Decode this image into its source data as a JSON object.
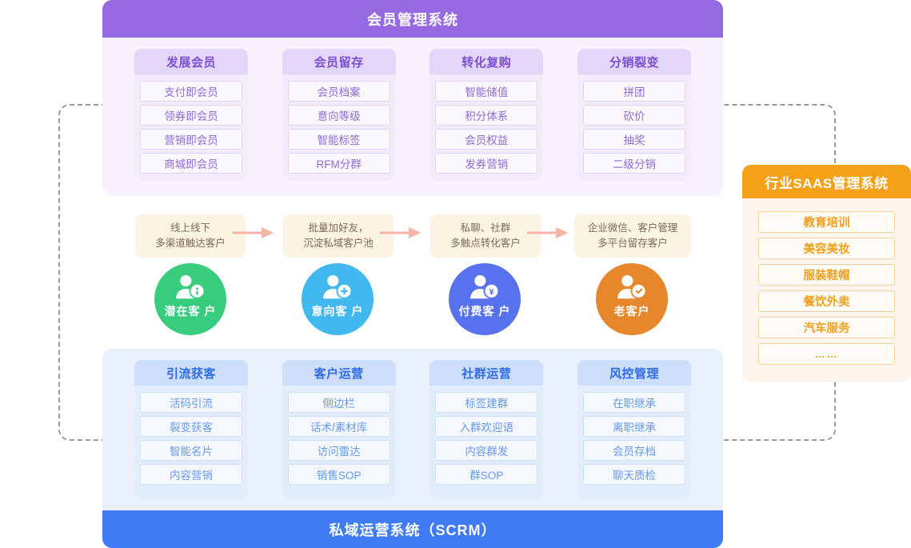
{
  "frame": {
    "border_color": "#9a9a9a"
  },
  "top_panel": {
    "title": "会员管理系统",
    "header_color": "#9569E0",
    "body_color": "#F7F2FE",
    "columns": [
      {
        "title": "发展会员",
        "items": [
          "支付即会员",
          "领券即会员",
          "营销即会员",
          "商城即会员"
        ]
      },
      {
        "title": "会员留存",
        "items": [
          "会员档案",
          "意向等级",
          "智能标签",
          "RFM分群"
        ]
      },
      {
        "title": "转化复购",
        "items": [
          "智能储值",
          "积分体系",
          "会员权益",
          "发券营销"
        ]
      },
      {
        "title": "分销裂变",
        "items": [
          "拼团",
          "砍价",
          "抽奖",
          "二级分销"
        ]
      }
    ]
  },
  "flow": {
    "callouts": [
      {
        "line1": "线上线下",
        "line2": "多渠道触达客户"
      },
      {
        "line1": "批量加好友，",
        "line2": "沉淀私域客户池"
      },
      {
        "line1": "私聊、社群",
        "line2": "多触点转化客户"
      },
      {
        "line1": "企业微信、客户管理",
        "line2": "多平台留存客户"
      }
    ],
    "nodes": [
      {
        "label": "潜在客 户",
        "color": "#38CC7F",
        "icon": "person-info-icon"
      },
      {
        "label": "意向客 户",
        "color": "#41B9EE",
        "icon": "person-add-icon"
      },
      {
        "label": "付费客 户",
        "color": "#5871EE",
        "icon": "person-yuan-icon"
      },
      {
        "label": "老客户",
        "color": "#E8862C",
        "icon": "person-check-icon"
      }
    ],
    "arrow_color": "#F9B3A6",
    "arrow_icon": "arrow-right-icon"
  },
  "bottom_panel": {
    "title": "私域运营系统（SCRM）",
    "header_color": "#3E7BF5",
    "body_color": "#EAF1FD",
    "columns": [
      {
        "title": "引流获客",
        "items": [
          "活码引流",
          "裂变获客",
          "智能名片",
          "内容营销"
        ]
      },
      {
        "title": "客户运营",
        "items": [
          "侧边栏",
          "话术/素材库",
          "访问雷达",
          "销售SOP"
        ]
      },
      {
        "title": "社群运营",
        "items": [
          "标签建群",
          "入群欢迎语",
          "内容群发",
          "群SOP"
        ]
      },
      {
        "title": "风控管理",
        "items": [
          "在职继承",
          "离职继承",
          "会员存档",
          "聊天质检"
        ]
      }
    ]
  },
  "side_panel": {
    "title": "行业SAAS管理系统",
    "header_color": "#F4A117",
    "body_color": "#FDF5EC",
    "items": [
      "教育培训",
      "美容美妆",
      "服装鞋帽",
      "餐饮外卖",
      "汽车服务",
      "……"
    ]
  }
}
